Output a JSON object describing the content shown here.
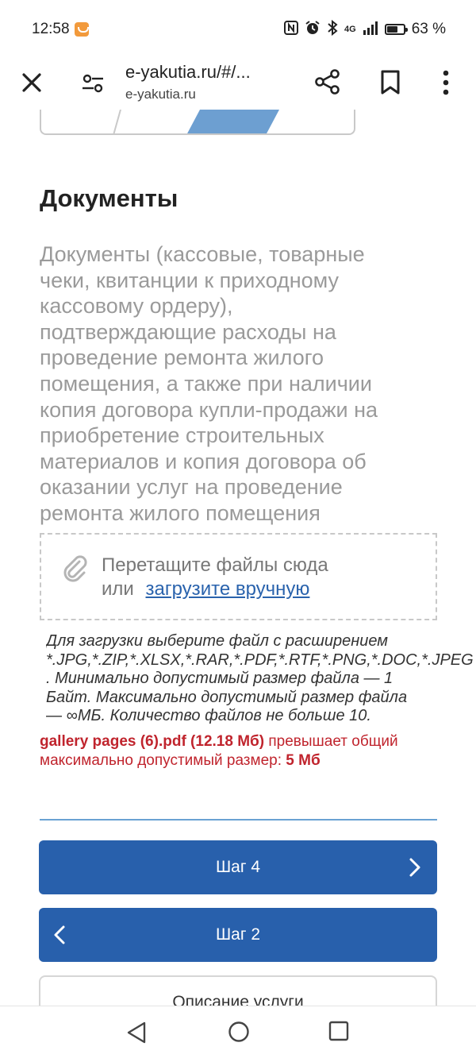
{
  "status_bar": {
    "time": "12:58",
    "network": "4G",
    "battery_percent": "63 %",
    "battery_level": 0.63,
    "icons": [
      "nfc-icon",
      "alarm-icon",
      "bluetooth-icon",
      "signal-icon",
      "battery-icon"
    ]
  },
  "browser": {
    "url_main": "e-yakutia.ru/#/...",
    "url_sub": "e-yakutia.ru"
  },
  "section": {
    "title": "Документы",
    "description_lines": [
      "Документы (кассовые, товарные",
      "чеки, квитанции к приходному",
      "кассовому ордеру),",
      "подтверждающие расходы на",
      "проведение ремонта жилого",
      "помещения, а также при наличии",
      "копия договора купли-продажи на",
      "приобретение строительных",
      "материалов и копия договора об",
      "оказании услуг на проведение",
      "ремонта жилого помещения"
    ]
  },
  "dropzone": {
    "line1": "Перетащите файлы сюда",
    "or_text": "или",
    "upload_link": "загрузите вручную"
  },
  "hint_lines": [
    "Для загрузки выберите файл с расширением",
    "*.JPG,*.ZIP,*.XLSX,*.RAR,*.PDF,*.RTF,*.PNG,*.DOC,*.JPEG",
    ". Минимально допустимый размер файла — 1",
    "Байт. Максимально допустимый размер файла",
    "— ∞МБ. Количество файлов не больше 10."
  ],
  "error": {
    "file_name": "gallery pages (6).pdf (12.18 Мб)",
    "text_1": " превышает общий",
    "text_2": "максимально допустимый размер: ",
    "limit": "5 Мб"
  },
  "buttons": {
    "next": "Шаг 4",
    "prev": "Шаг 2",
    "service_description": "Описание услуги"
  },
  "colors": {
    "primary": "#2860ac",
    "link": "#2a63ad",
    "error": "#c0242d",
    "stepper_active": "#6d9fd1"
  }
}
